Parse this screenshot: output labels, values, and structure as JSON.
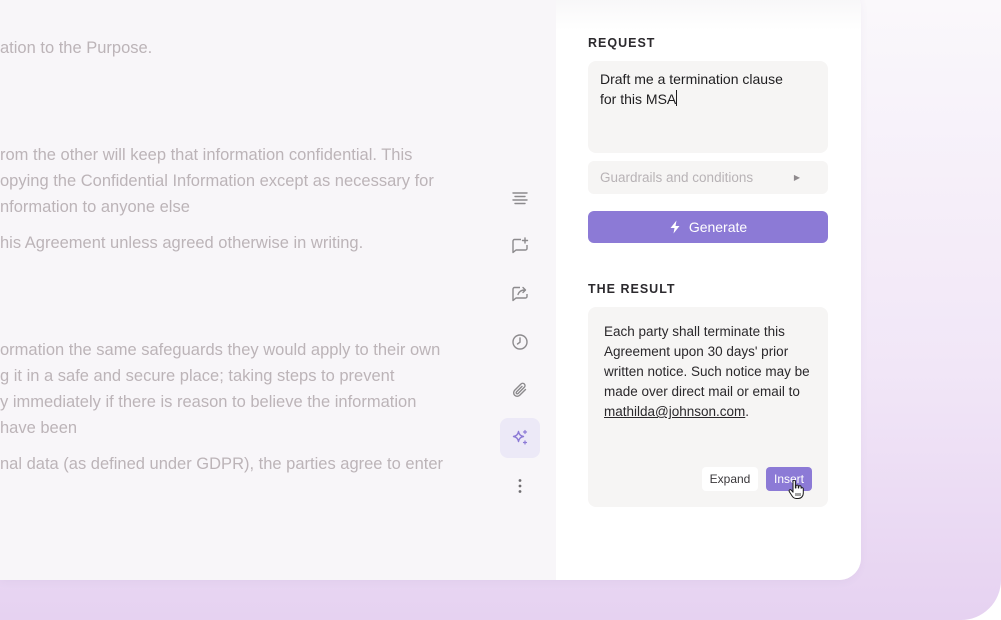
{
  "document": {
    "lines": [
      "ation to the Purpose.",
      "rom the other will keep that information confidential. This",
      "opying the Confidential Information except as necessary for",
      "nformation to anyone else",
      "his Agreement unless agreed otherwise in writing.",
      "ormation the same safeguards they would apply to their own",
      "g it in a safe and secure place; taking steps to prevent",
      "y immediately if there is reason to believe the information",
      "have been",
      "nal data (as defined under GDPR), the parties agree to enter"
    ]
  },
  "toolbar": {
    "tools": [
      {
        "icon": "align-text-icon"
      },
      {
        "icon": "add-comment-icon"
      },
      {
        "icon": "share-icon"
      },
      {
        "icon": "history-icon"
      },
      {
        "icon": "attachment-icon"
      },
      {
        "icon": "sparkle-ai-icon",
        "active": true
      },
      {
        "icon": "more-options-icon"
      }
    ]
  },
  "panel": {
    "request_title": "REQUEST",
    "request_text": "Draft me a termination clause for this MSA",
    "guardrails_label": "Guardrails and conditions",
    "guardrails_arrow": "▶",
    "generate_label": "Generate",
    "result_title": "THE RESULT",
    "result_text": "Each party shall terminate this Agreement upon 30 days' prior written notice. Such notice may be made over direct mail or email to",
    "result_email": "mathilda@johnson.com",
    "result_period": ".",
    "expand_label": "Expand",
    "insert_label": "Insert"
  },
  "colors": {
    "accent": "#8c7ad6",
    "active_tool_bg": "#ece9f7",
    "outer_bg": "#e6d2f1"
  }
}
